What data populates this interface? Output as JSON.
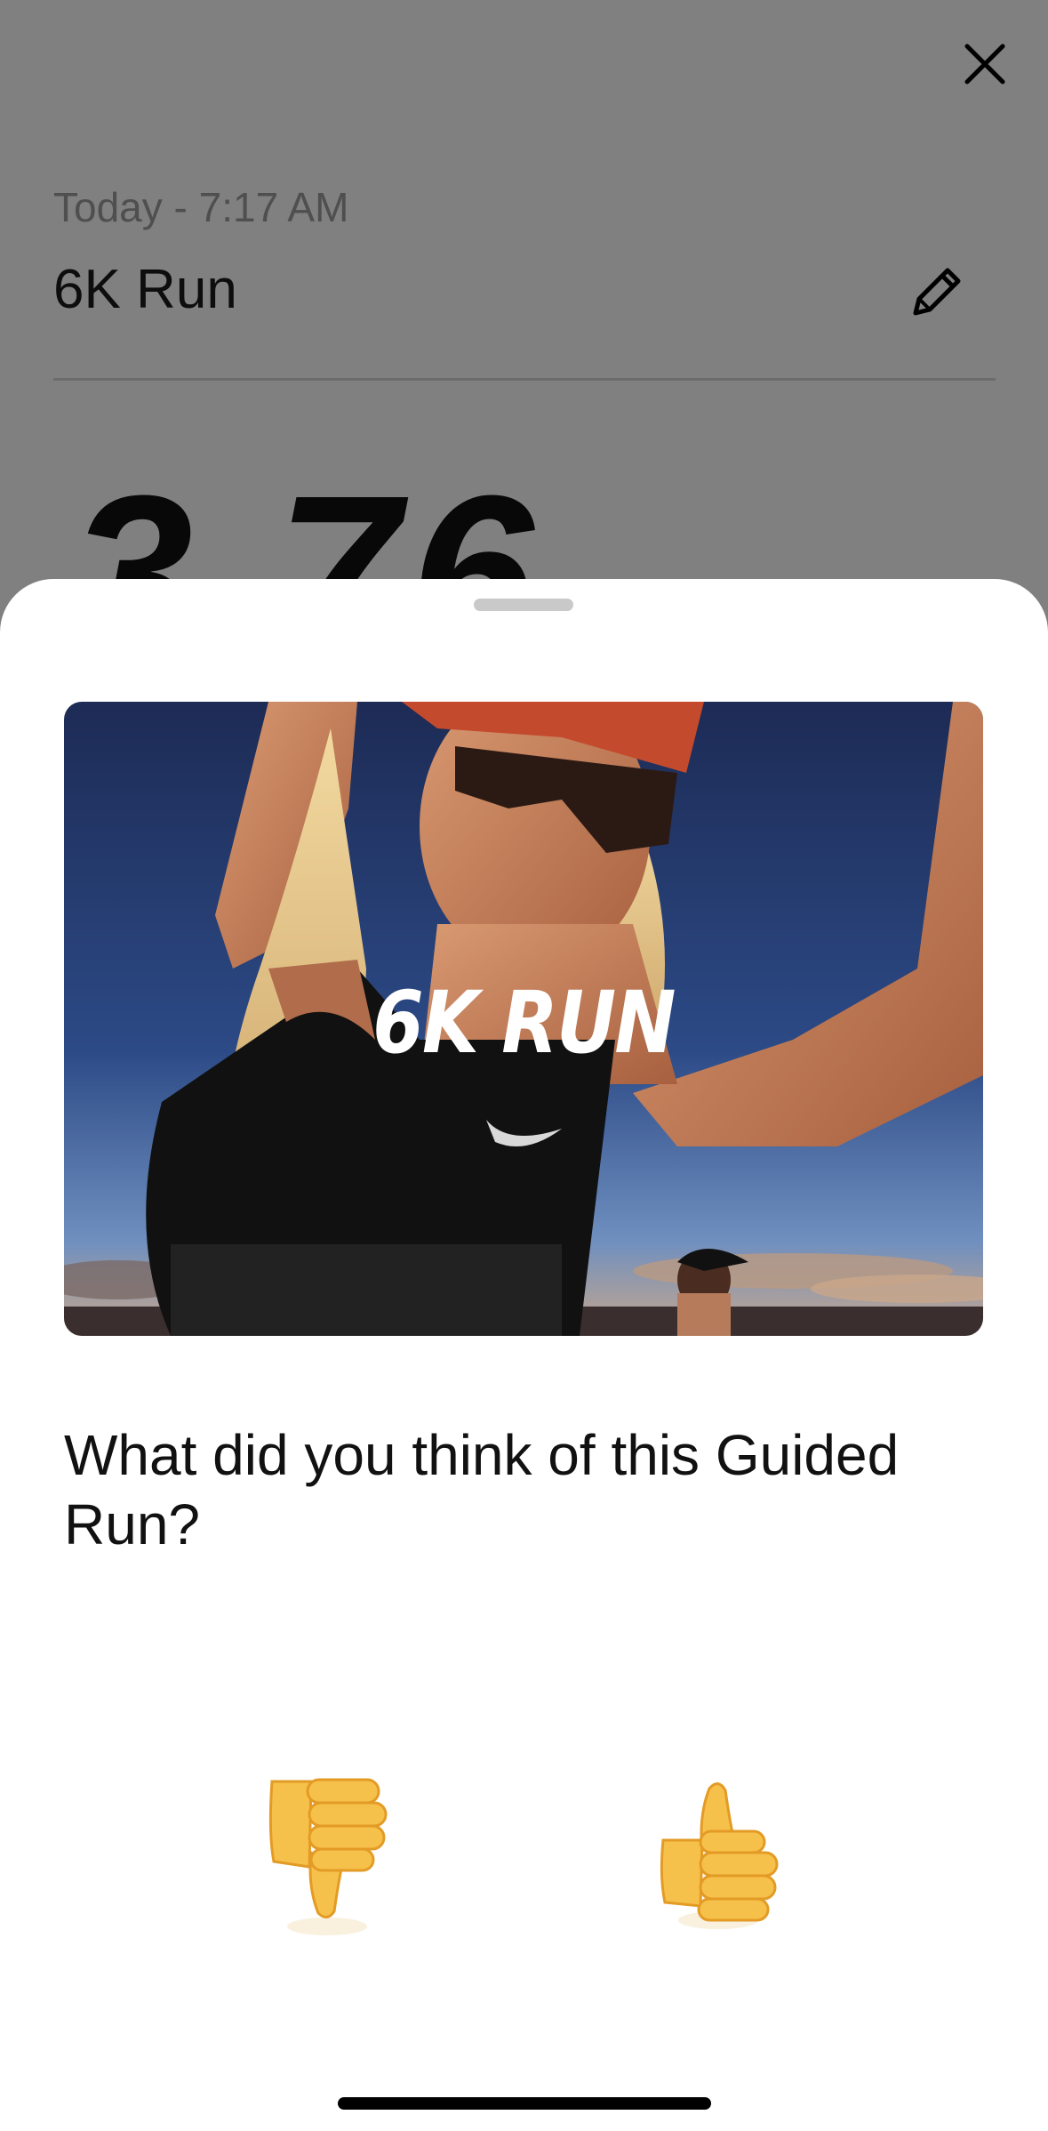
{
  "background_screen": {
    "date_label": "Today - 7:17 AM",
    "title": "6K Run",
    "stat_value": "3.76",
    "close_icon": "close-icon",
    "edit_icon": "pencil-icon"
  },
  "sheet": {
    "hero_title": "6K RUN",
    "question": "What did you think of this Guided Run?",
    "rating_options": [
      {
        "name": "thumbs-down",
        "icon": "thumbs-down-icon"
      },
      {
        "name": "thumbs-up",
        "icon": "thumbs-up-icon"
      }
    ]
  },
  "colors": {
    "dim_overlay": "#808080",
    "sheet_background": "#ffffff",
    "thumb_fill": "#f6c14b",
    "thumb_shade": "#e39b25"
  }
}
